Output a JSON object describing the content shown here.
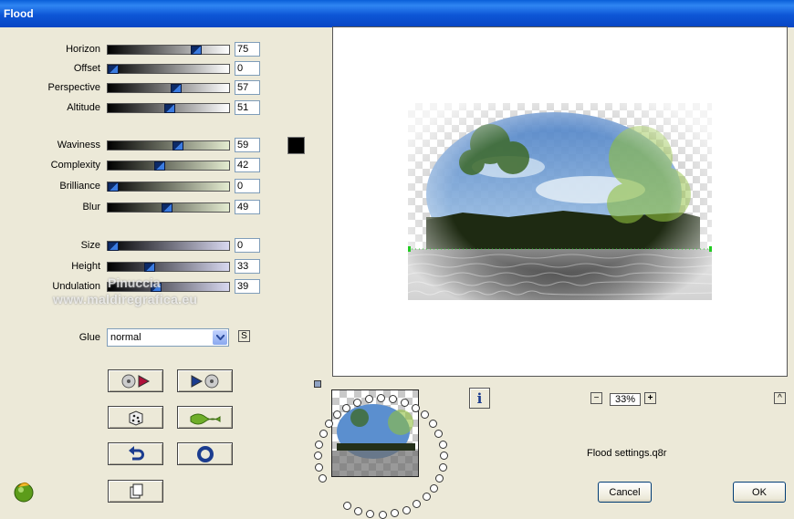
{
  "window": {
    "title": "Flood"
  },
  "sliders": [
    {
      "label": "Horizon",
      "value": "75"
    },
    {
      "label": "Offset",
      "value": "0"
    },
    {
      "label": "Perspective",
      "value": "57"
    },
    {
      "label": "Altitude",
      "value": "51"
    },
    {
      "label": "Waviness",
      "value": "59"
    },
    {
      "label": "Complexity",
      "value": "42"
    },
    {
      "label": "Brilliance",
      "value": "0"
    },
    {
      "label": "Blur",
      "value": "49"
    },
    {
      "label": "Size",
      "value": "0"
    },
    {
      "label": "Height",
      "value": "33"
    },
    {
      "label": "Undulation",
      "value": "39"
    }
  ],
  "watermark": {
    "line1": "Pinuccia",
    "line2": "www.maldiregrafica.eu"
  },
  "glue": {
    "label": "Glue",
    "selected": "normal",
    "side_button": "S"
  },
  "zoom": {
    "value": "33%",
    "minus": "−",
    "plus": "+"
  },
  "settings_file": "Flood settings.q8r",
  "buttons": {
    "cancel": "Cancel",
    "ok": "OK",
    "info": "i",
    "collapse": "^"
  },
  "icons": {
    "load": "load-settings-icon",
    "save": "save-settings-icon",
    "random": "dice-icon",
    "wave": "wave-icon",
    "undo": "undo-icon",
    "reset": "reset-icon",
    "copy": "copy-icon",
    "logo": "app-logo-icon"
  }
}
